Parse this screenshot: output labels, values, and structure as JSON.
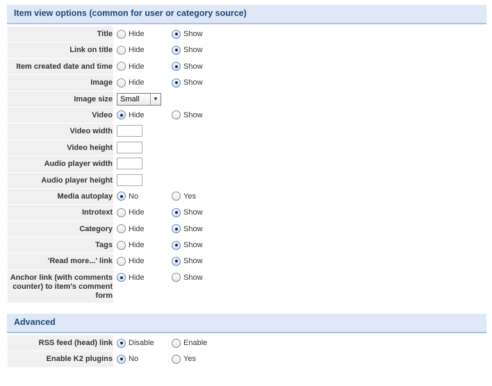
{
  "sections": [
    {
      "title": "Item view options (common for user or category source)",
      "rows": [
        {
          "label": "Title",
          "type": "radio",
          "options": [
            "Hide",
            "Show"
          ],
          "selected": 1
        },
        {
          "label": "Link on title",
          "type": "radio",
          "options": [
            "Hide",
            "Show"
          ],
          "selected": 1
        },
        {
          "label": "Item created date and time",
          "type": "radio",
          "options": [
            "Hide",
            "Show"
          ],
          "selected": 1
        },
        {
          "label": "Image",
          "type": "radio",
          "options": [
            "Hide",
            "Show"
          ],
          "selected": 1
        },
        {
          "label": "Image size",
          "type": "select",
          "value": "Small"
        },
        {
          "label": "Video",
          "type": "radio",
          "options": [
            "Hide",
            "Show"
          ],
          "selected": 0
        },
        {
          "label": "Video width",
          "type": "text",
          "value": ""
        },
        {
          "label": "Video height",
          "type": "text",
          "value": ""
        },
        {
          "label": "Audio player width",
          "type": "text",
          "value": ""
        },
        {
          "label": "Audio player height",
          "type": "text",
          "value": ""
        },
        {
          "label": "Media autoplay",
          "type": "radio",
          "options": [
            "No",
            "Yes"
          ],
          "selected": 0
        },
        {
          "label": "Introtext",
          "type": "radio",
          "options": [
            "Hide",
            "Show"
          ],
          "selected": 1
        },
        {
          "label": "Category",
          "type": "radio",
          "options": [
            "Hide",
            "Show"
          ],
          "selected": 1
        },
        {
          "label": "Tags",
          "type": "radio",
          "options": [
            "Hide",
            "Show"
          ],
          "selected": 1
        },
        {
          "label": "'Read more...' link",
          "type": "radio",
          "options": [
            "Hide",
            "Show"
          ],
          "selected": 1
        },
        {
          "label": "Anchor link (with comments counter) to item's comment form",
          "type": "radio",
          "options": [
            "Hide",
            "Show"
          ],
          "selected": 0,
          "tall": true
        }
      ]
    },
    {
      "title": "Advanced",
      "rows": [
        {
          "label": "RSS feed (head) link",
          "type": "radio",
          "options": [
            "Disable",
            "Enable"
          ],
          "selected": 0
        },
        {
          "label": "Enable K2 plugins",
          "type": "radio",
          "options": [
            "No",
            "Yes"
          ],
          "selected": 0
        }
      ]
    }
  ]
}
